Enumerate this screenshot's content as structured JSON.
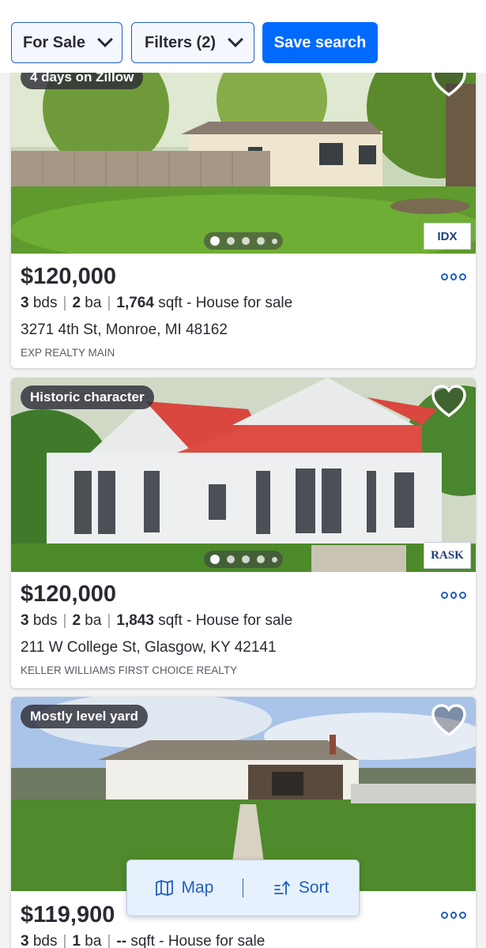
{
  "toolbar": {
    "for_sale_label": "For Sale",
    "filters_label": "Filters (2)",
    "save_label": "Save search"
  },
  "listings": [
    {
      "tag": "4 days on Zillow",
      "price": "$120,000",
      "beds": "3",
      "beds_unit": "bds",
      "baths": "2",
      "baths_unit": "ba",
      "sqft": "1,764",
      "sqft_unit": "sqft",
      "type": "- House for sale",
      "address": "3271 4th St, Monroe, MI 48162",
      "broker": "EXP REALTY MAIN",
      "badge": "IDX",
      "photo_index": 1,
      "photo_count": 5
    },
    {
      "tag": "Historic character",
      "price": "$120,000",
      "beds": "3",
      "beds_unit": "bds",
      "baths": "2",
      "baths_unit": "ba",
      "sqft": "1,843",
      "sqft_unit": "sqft",
      "type": "- House for sale",
      "address": "211 W College St, Glasgow, KY 42141",
      "broker": "KELLER WILLIAMS FIRST CHOICE REALTY",
      "badge": "RASK",
      "photo_index": 1,
      "photo_count": 5
    },
    {
      "tag": "Mostly level yard",
      "price": "$119,900",
      "beds": "3",
      "beds_unit": "bds",
      "baths": "1",
      "baths_unit": "ba",
      "sqft": "--",
      "sqft_unit": "sqft",
      "type": "- House for sale"
    }
  ],
  "floating": {
    "map_label": "Map",
    "sort_label": "Sort"
  },
  "icons": {
    "heart": "heart-outline-icon",
    "more": "more-options-icon",
    "map": "map-icon",
    "sort": "sort-icon",
    "chevron": "chevron-down-icon"
  },
  "colors": {
    "accent": "#006aff",
    "link": "#1f5fc4",
    "text": "#2a2a33"
  }
}
